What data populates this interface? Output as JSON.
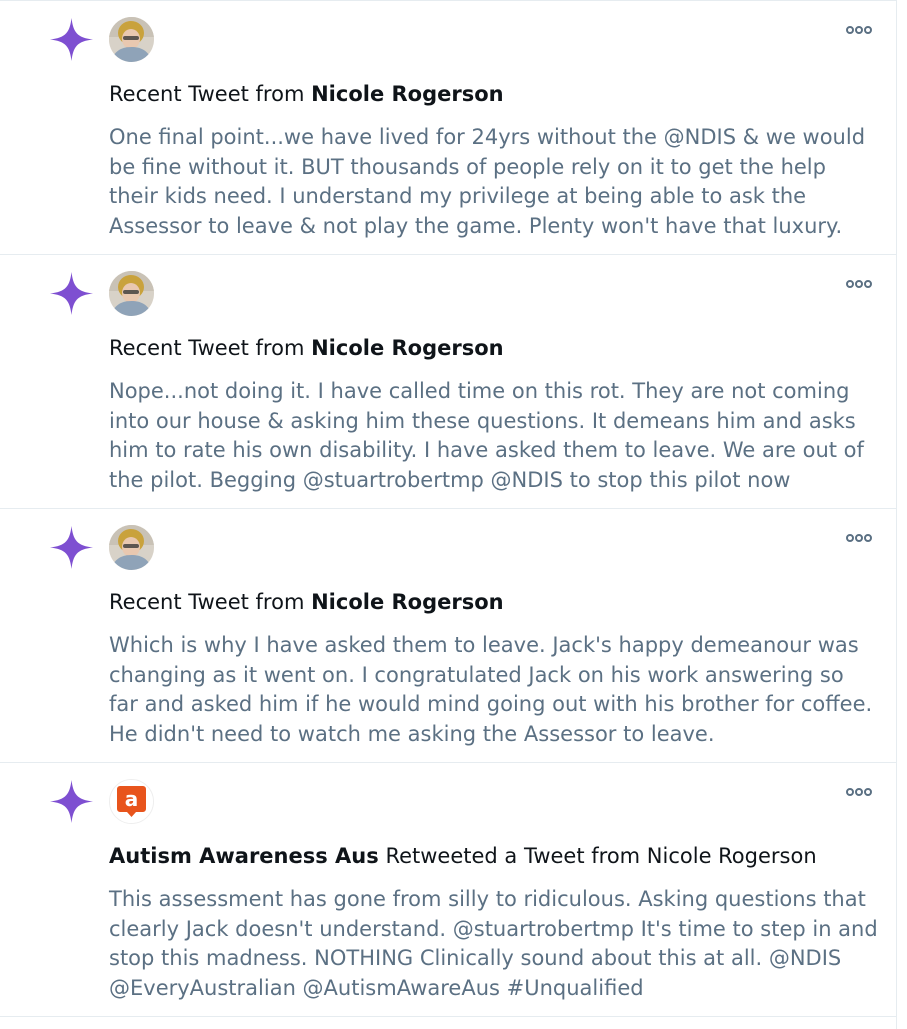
{
  "feed": {
    "items": [
      {
        "avatar": "woman-portrait-avatar",
        "header_prefix": "Recent Tweet from",
        "header_name": "Nicole Rogerson",
        "header_suffix": "",
        "text": "One final point...we have lived for 24yrs without the @NDIS & we would be fine without it. BUT thousands of people rely on it to get the help their kids need. I understand my privilege at being able to ask the Assessor to leave & not play the game. Plenty won't have that luxury."
      },
      {
        "avatar": "woman-portrait-avatar",
        "header_prefix": "Recent Tweet from",
        "header_name": "Nicole Rogerson",
        "header_suffix": "",
        "text": "Nope...not doing it. I have called time on this rot. They are not coming into our house & asking him these questions. It demeans him and asks him to rate his own disability. I have asked them to leave. We are out of the pilot. Begging @stuartrobertmp @NDIS to stop this pilot now"
      },
      {
        "avatar": "woman-portrait-avatar",
        "header_prefix": "Recent Tweet from",
        "header_name": "Nicole Rogerson",
        "header_suffix": "",
        "text": "Which is why I have asked them to leave. Jack's happy demeanour was changing as it went on. I congratulated Jack on his work answering so far and asked him if he would mind going out with his brother for coffee. He didn't need to watch me asking the Assessor to leave."
      },
      {
        "avatar": "autism-awareness-logo-avatar",
        "header_prefix": "",
        "header_name": "Autism Awareness Aus",
        "header_suffix": "Retweeted a Tweet from Nicole Rogerson",
        "text": "This assessment has gone from silly to ridiculous. Asking questions that clearly Jack doesn't understand. @stuartrobertmp It's time to step in and stop this madness. NOTHING Clinically sound about this at all. @NDIS @EveryAustralian @AutismAwareAus #Unqualified"
      }
    ]
  },
  "icons": {
    "spark": "sparkle-icon",
    "more": "more-options-icon"
  },
  "colors": {
    "sparkle": "#7e4fd1",
    "body_text": "#5b7083",
    "header_text": "#0f1419",
    "divider": "#e6ecf0",
    "brand_orange": "#e8541c"
  }
}
